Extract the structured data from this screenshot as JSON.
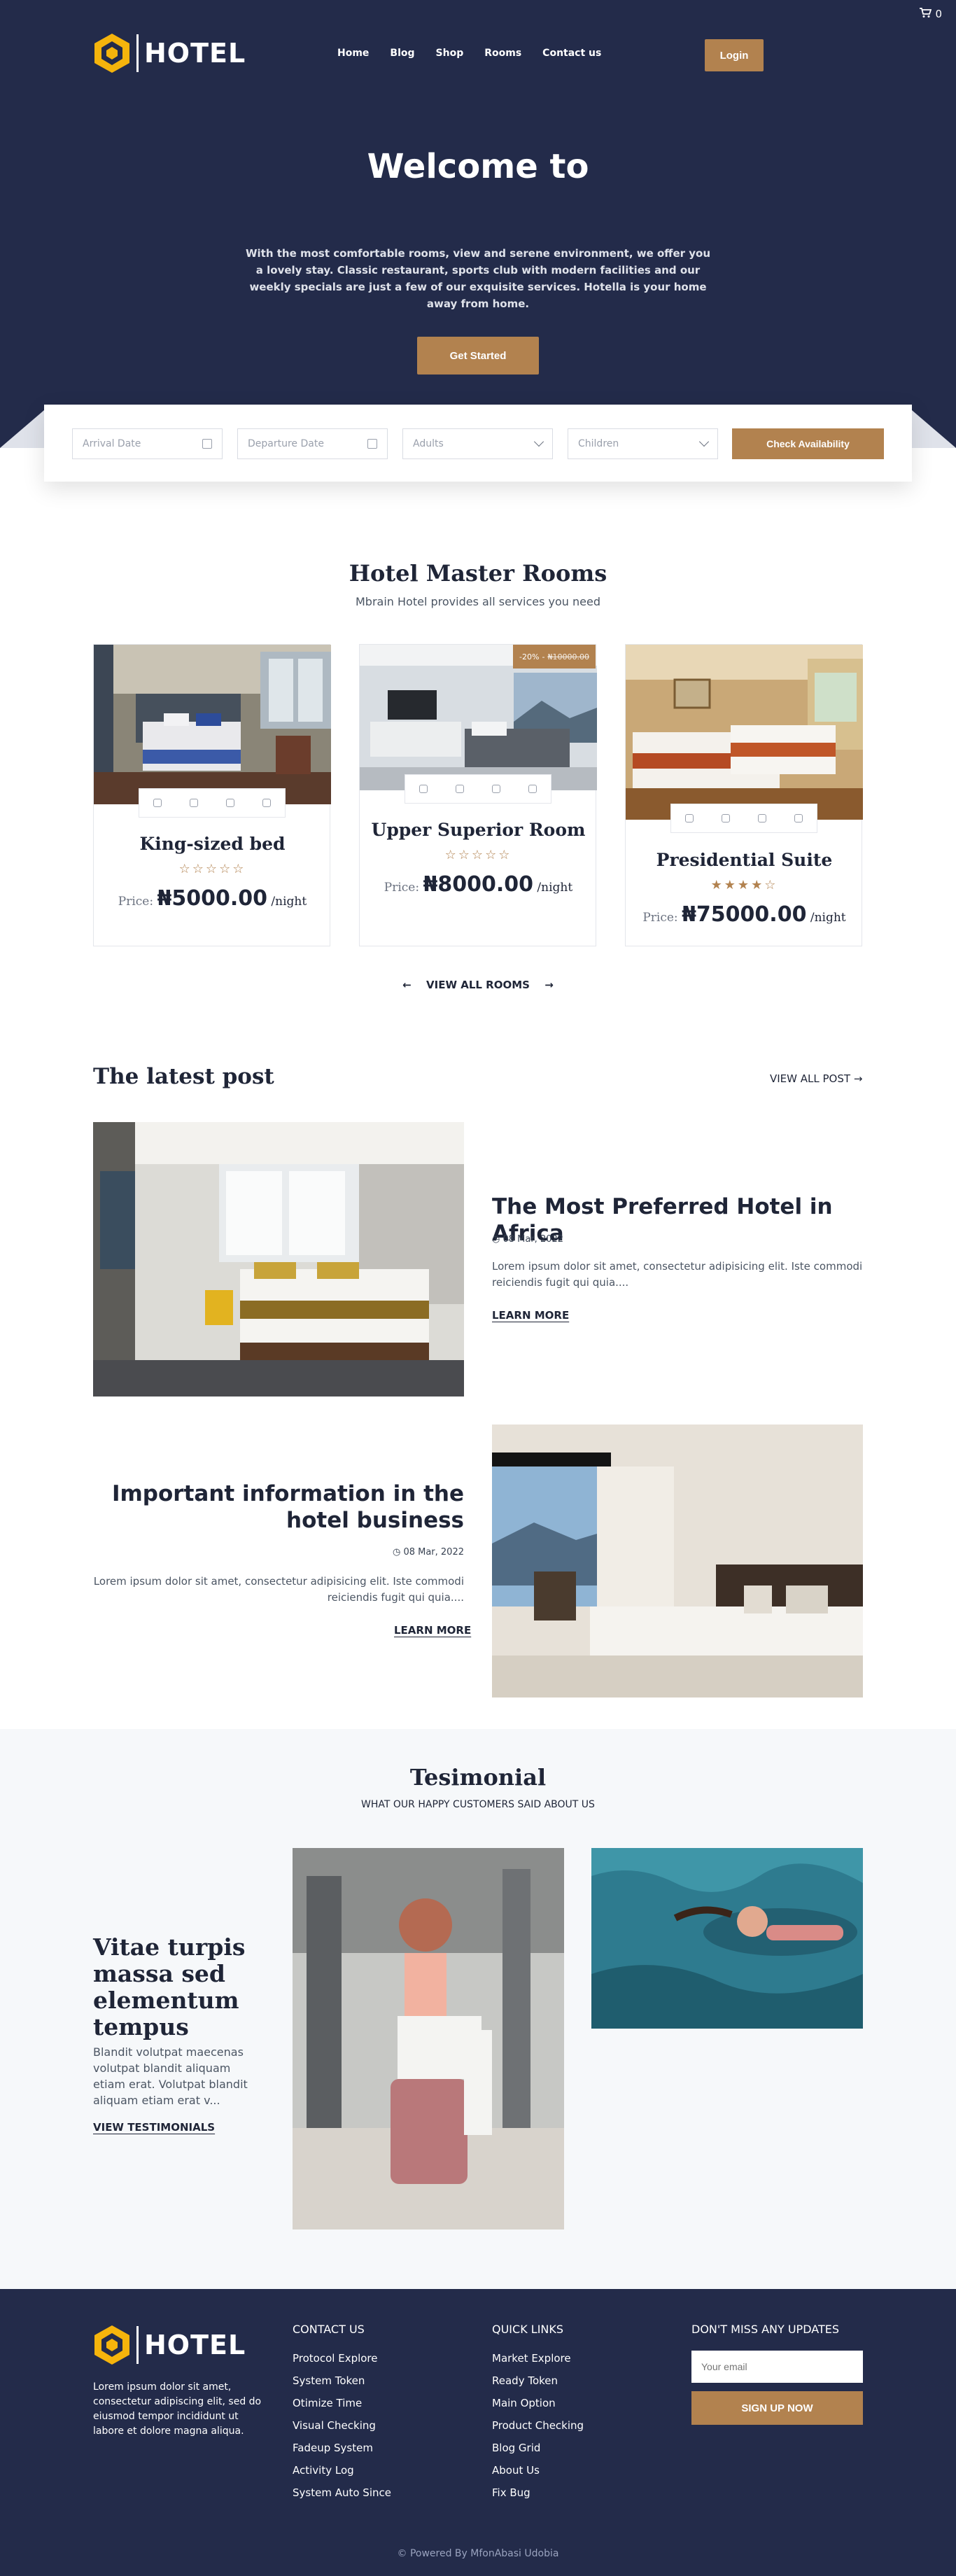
{
  "colors": {
    "navy": "#232b4a",
    "gold": "#b2824f",
    "hex_yellow": "#f5b40c"
  },
  "header": {
    "logo_word": "HOTEL",
    "cart_count": "0",
    "nav": [
      "Home",
      "Blog",
      "Shop",
      "Rooms",
      "Contact us"
    ],
    "login": "Login"
  },
  "hero": {
    "title": "Welcome to",
    "subtitle": "With the most comfortable rooms, view and serene environment, we offer you a lovely stay. Classic restaurant, sports club with modern facilities and our weekly specials are just a few of our exquisite services. Hotella is your home away from home.",
    "cta": "Get Started"
  },
  "booking": {
    "arrival_placeholder": "Arrival Date",
    "departure_placeholder": "Departure Date",
    "adults": "Adults",
    "children": "Children",
    "check": "Check Availability"
  },
  "rooms": {
    "title": "Hotel Master Rooms",
    "subtitle": "Mbrain Hotel provides all services you need",
    "items": [
      {
        "name": "King-sized bed",
        "rating": 0,
        "stars": "☆☆☆☆☆",
        "price_label": "Price:",
        "price": "₦5000.00",
        "per": "/night"
      },
      {
        "name": "Upper Superior Room",
        "rating": 0,
        "stars": "☆☆☆☆☆",
        "price_label": "Price:",
        "price": "₦8000.00",
        "per": "/night",
        "badge_pct": "-20%",
        "badge_old": "₦10000.00"
      },
      {
        "name": "Presidential Suite",
        "rating": 4,
        "stars": "★★★★☆",
        "price_label": "Price:",
        "price": "₦75000.00",
        "per": "/night"
      }
    ],
    "view_all": "VIEW ALL ROOMS"
  },
  "posts": {
    "title": "The latest post",
    "view_all": "VIEW ALL POST",
    "items": [
      {
        "title": "The Most Preferred Hotel in Africa",
        "date": "08 Mar, 2022",
        "text": "Lorem ipsum dolor sit amet, consectetur adipisicing elit. Iste commodi reiciendis fugit qui quia....",
        "more": "LEARN MORE"
      },
      {
        "title": "Important information in the hotel business",
        "date": "08 Mar, 2022",
        "text": "Lorem ipsum dolor sit amet, consectetur adipisicing elit. Iste commodi reiciendis fugit qui quia....",
        "more": "LEARN MORE"
      }
    ]
  },
  "testimonial": {
    "title": "Tesimonial",
    "subtitle": "WHAT OUR HAPPY CUSTOMERS SAID ABOUT US",
    "heading": "Vitae turpis massa sed elementum tempus",
    "text": "Blandit volutpat maecenas volutpat blandit aliquam etiam erat. Volutpat blandit aliquam etiam erat v...",
    "link": "VIEW TESTIMONIALS"
  },
  "footer": {
    "logo_word": "HOTEL",
    "about": "Lorem ipsum dolor sit amet, consectetur adipiscing elit, sed do eiusmod tempor incididunt ut labore et dolore magna aliqua.",
    "contact_title": "CONTACT US",
    "contact_items": [
      "Protocol Explore",
      "System Token",
      "Otimize Time",
      "Visual Checking",
      "Fadeup System",
      "Activity Log",
      "System Auto Since"
    ],
    "links_title": "QUICK LINKS",
    "link_items": [
      "Market Explore",
      "Ready Token",
      "Main Option",
      "Product Checking",
      "Blog Grid",
      "About Us",
      "Fix Bug"
    ],
    "news_title": "DON'T MISS ANY UPDATES",
    "email_placeholder": "Your email",
    "signup": "SIGN UP NOW",
    "powered": "© Powered By MfonAbasi Udobia"
  }
}
